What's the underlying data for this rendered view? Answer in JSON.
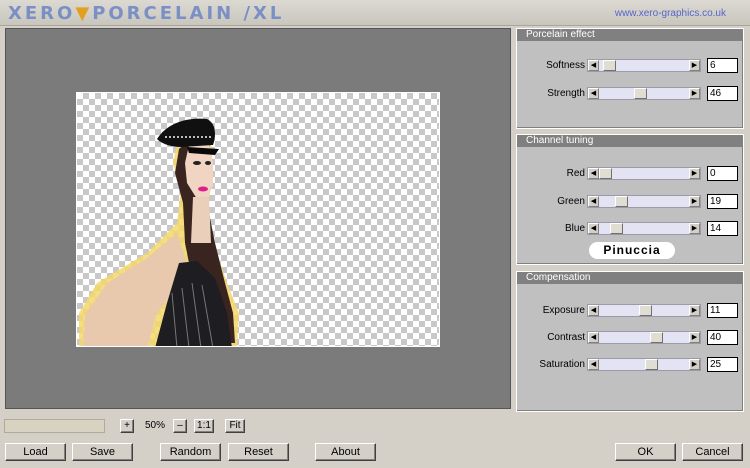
{
  "title": {
    "logo_a": "XERO",
    "logo_b": "PORCELAIN /XL",
    "url": "www.xero-graphics.co.uk"
  },
  "panels": {
    "porcelain": {
      "header": "Porcelain effect",
      "controls": [
        {
          "label": "Softness",
          "value": "6",
          "level": 0.14
        },
        {
          "label": "Strength",
          "value": "46",
          "level": 0.46
        }
      ]
    },
    "channel": {
      "header": "Channel tuning",
      "controls": [
        {
          "label": "Red",
          "value": "0",
          "level": 0.0
        },
        {
          "label": "Green",
          "value": "19",
          "level": 0.2
        },
        {
          "label": "Blue",
          "value": "14",
          "level": 0.14
        }
      ],
      "badge": "Pinuccia"
    },
    "compensation": {
      "header": "Compensation",
      "controls": [
        {
          "label": "Exposure",
          "value": "11",
          "level": 0.46
        },
        {
          "label": "Contrast",
          "value": "40",
          "level": 0.6
        },
        {
          "label": "Saturation",
          "value": "25",
          "level": 0.55
        }
      ]
    }
  },
  "zoom": {
    "plus": "+",
    "value": "50%",
    "minus": "–",
    "actual": "1:1",
    "fit": "Fit"
  },
  "buttons": {
    "load": "Load",
    "save": "Save",
    "random": "Random",
    "reset": "Reset",
    "about": "About",
    "ok": "OK",
    "cancel": "Cancel"
  },
  "colors": {
    "panel_header": "#808080",
    "preview_bg": "#7b7b7b",
    "logo": "#7a8fc4",
    "logo_accent": "#e0a020",
    "slider_track": "#e3e3f3"
  }
}
